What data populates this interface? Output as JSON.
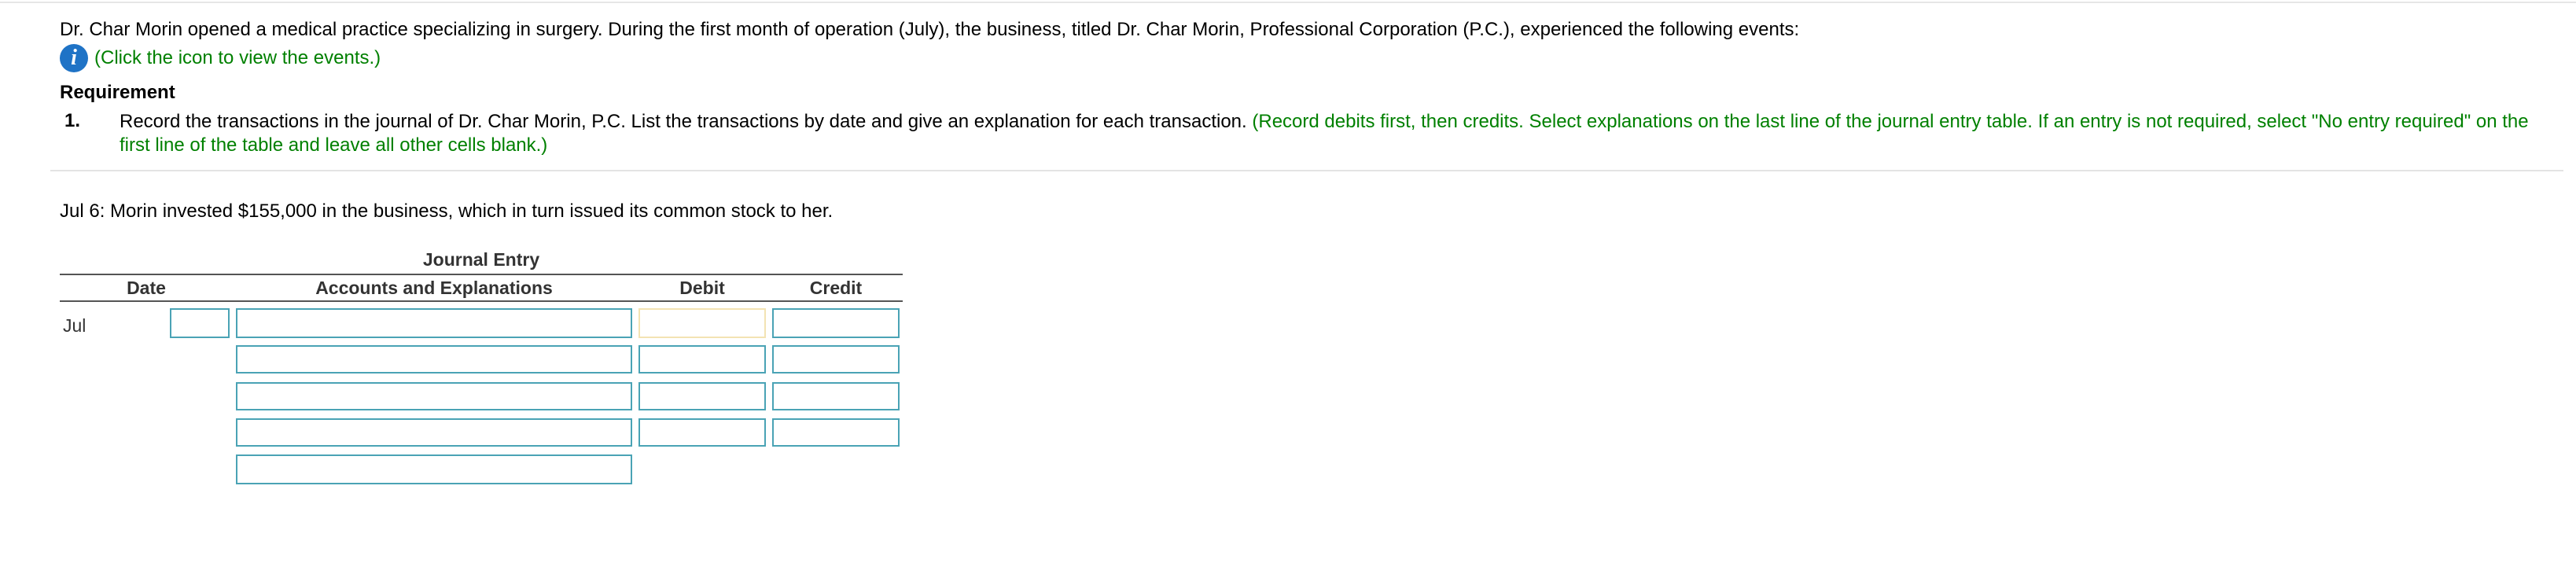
{
  "problem": {
    "intro": "Dr. Char Morin opened a medical practice specializing in surgery. During the first month of operation (July), the business, titled Dr. Char Morin, Professional Corporation (P.C.), experienced the following events:",
    "info_icon": "info-icon",
    "info_icon_glyph": "i",
    "click_hint": "(Click the icon to view the events.)",
    "requirement_title": "Requirement",
    "requirement_number": "1.",
    "requirement_text": "Record the transactions in the journal of Dr. Char Morin, P.C. List the transactions by date and give an explanation for each transaction.",
    "requirement_instructions": "(Record debits first, then credits. Select explanations on the last line of the journal entry table. If an entry is not required, select \"No entry required\" on the first line of the table and leave all other cells blank.)"
  },
  "transaction": {
    "text": "Jul 6: Morin invested $155,000 in the business, which in turn issued its common stock to her."
  },
  "journal": {
    "title": "Journal Entry",
    "headers": {
      "date": "Date",
      "accounts": "Accounts and Explanations",
      "debit": "Debit",
      "credit": "Credit"
    },
    "month": "Jul",
    "rows": [
      {
        "day": "",
        "account": "",
        "debit": "",
        "credit": ""
      },
      {
        "account": "",
        "debit": "",
        "credit": ""
      },
      {
        "account": "",
        "debit": "",
        "credit": ""
      },
      {
        "account": "",
        "debit": "",
        "credit": ""
      },
      {
        "explanation": ""
      }
    ]
  },
  "colors": {
    "instruction_green": "#008000",
    "info_icon_blue": "#1f73c6",
    "input_border": "#4aa3b5",
    "focused_debit_border": "#f3e3b3"
  }
}
